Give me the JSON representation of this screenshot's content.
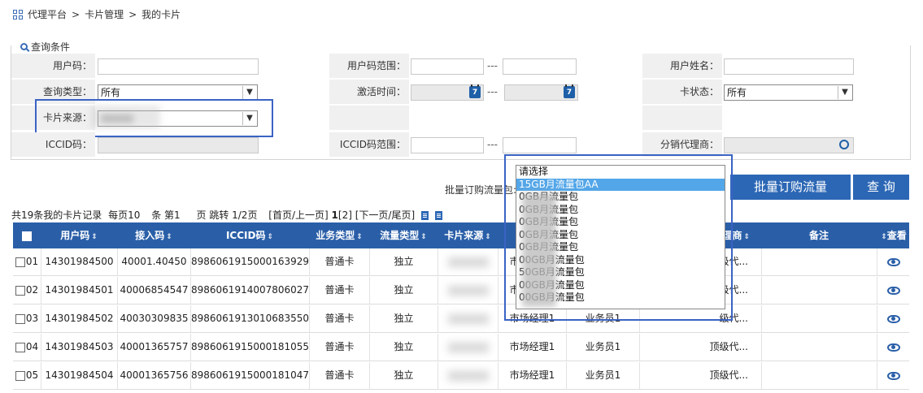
{
  "breadcrumb": {
    "items": [
      "代理平台",
      ">",
      "卡片管理",
      ">",
      "我的卡片"
    ]
  },
  "query": {
    "title": "查询条件",
    "user_code_label": "用户码：",
    "user_code_range_label": "用户码范围：",
    "user_name_label": "用户姓名：",
    "query_type_label": "查询类型：",
    "query_type_value": "所有",
    "activation_time_label": "激活时间：",
    "card_status_label": "卡状态：",
    "card_status_value": "所有",
    "card_source_label": "卡片来源：",
    "iccid_label": "ICCID码：",
    "iccid_range_label": "ICCID码范围：",
    "distributor_label": "分销代理商：",
    "range_separator": "---",
    "calendar_glyph": "7"
  },
  "batch": {
    "label": "批量订购流量包:",
    "batch_button": "批量订购流量",
    "query_button": "查 询"
  },
  "dropdown": {
    "options": [
      {
        "label": "请选择",
        "selected": false
      },
      {
        "label": "15GB月流量包AA",
        "selected": true
      },
      {
        "label": "0GB月流量包",
        "selected": false
      },
      {
        "label": "0GB月流量包",
        "selected": false
      },
      {
        "label": "0GB月流量包",
        "selected": false
      },
      {
        "label": "0GB月流量包",
        "selected": false
      },
      {
        "label": "0GB月流量包",
        "selected": false
      },
      {
        "label": "00GB月流量包",
        "selected": false
      },
      {
        "label": "50GB月流量包",
        "selected": false
      },
      {
        "label": "00GB月流量包",
        "selected": false
      },
      {
        "label": "00GB月流量包",
        "selected": false
      }
    ]
  },
  "pager": {
    "summary": "共19条我的卡片记录",
    "per_page_label": "每页10",
    "unit_label": "条 第1",
    "page_label": "页 跳转 1/2页",
    "nav_first_prev": "[首页/上一页]",
    "current_page": "1",
    "other_page": "[2]",
    "nav_next_last": "[下一页/尾页]"
  },
  "table": {
    "columns": [
      "用户码",
      "接入码",
      "ICCID码",
      "业务类型",
      "流量类型",
      "卡片来源",
      "市场经理",
      "业务员",
      "理商",
      "备注",
      "查看"
    ],
    "rows": [
      {
        "no": "01",
        "user_code": "14301984500",
        "access_code": "40001.40450",
        "iccid": "89860619150001639290",
        "biz_type": "普通卡",
        "flow_type": "独立",
        "source": "江苏信创",
        "manager": "市场经理1",
        "salesman": "业务员1",
        "agent": "级代...",
        "remark": ""
      },
      {
        "no": "02",
        "user_code": "14301984501",
        "access_code": "40006854547",
        "iccid": "89860619140078060272",
        "biz_type": "普通卡",
        "flow_type": "独立",
        "source": "江苏信创",
        "manager": "市场经理1",
        "salesman": "业务员1",
        "agent": "级代...",
        "remark": ""
      },
      {
        "no": "03",
        "user_code": "14301984502",
        "access_code": "40030309835",
        "iccid": "89860619130106835506",
        "biz_type": "普通卡",
        "flow_type": "独立",
        "source": "江苏信创",
        "manager": "市场经理1",
        "salesman": "业务员1",
        "agent": "级代...",
        "remark": ""
      },
      {
        "no": "04",
        "user_code": "14301984503",
        "access_code": "40001365757",
        "iccid": "89860619150001810552",
        "biz_type": "普通卡",
        "flow_type": "独立",
        "source": "江苏信创",
        "manager": "市场经理1",
        "salesman": "业务员1",
        "agent": "顶级代...",
        "remark": ""
      },
      {
        "no": "05",
        "user_code": "14301984504",
        "access_code": "40001365756",
        "iccid": "89860619150001810479",
        "biz_type": "普通卡",
        "flow_type": "独立",
        "source": "江苏信创",
        "manager": "市场经理1",
        "salesman": "业务员1",
        "agent": "顶级代...",
        "remark": ""
      }
    ]
  },
  "colors": {
    "header_blue": "#2a5fa8",
    "button_blue": "#2c67b5",
    "highlight_border": "#3a63c4",
    "selected_option": "#53a6e8"
  }
}
